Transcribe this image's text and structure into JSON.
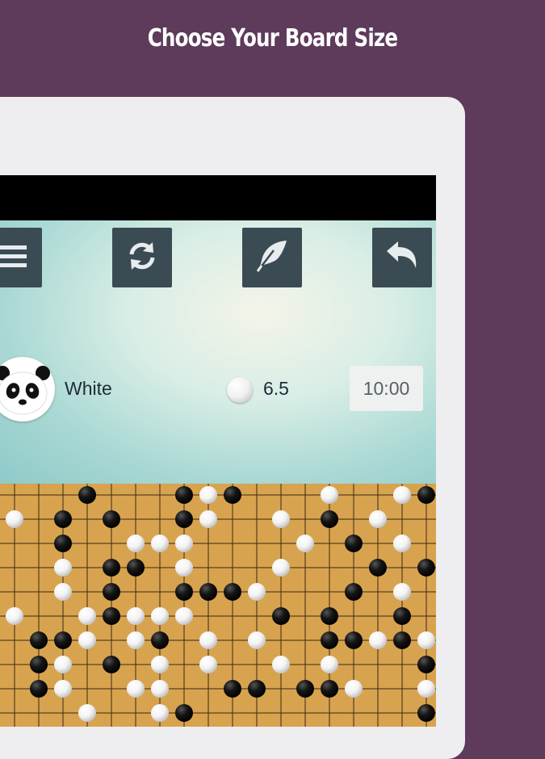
{
  "headline": "Choose Your Board Size",
  "toolbar": {
    "buttons": [
      {
        "icon": "menu-icon"
      },
      {
        "icon": "refresh-icon"
      },
      {
        "icon": "feather-icon"
      },
      {
        "icon": "undo-icon"
      }
    ]
  },
  "player": {
    "name": "White",
    "avatar": "panda-avatar",
    "komi": "6.5",
    "timer": "10:00"
  },
  "colors": {
    "background": "#5e3a5b",
    "toolbar_button": "#3b4b54",
    "board_wood": "#d8a34f"
  },
  "board": {
    "black": [
      [
        3,
        0
      ],
      [
        7,
        0
      ],
      [
        9,
        0
      ],
      [
        17,
        0
      ],
      [
        2,
        1
      ],
      [
        4,
        1
      ],
      [
        7,
        1
      ],
      [
        13,
        1
      ],
      [
        2,
        2
      ],
      [
        14,
        2
      ],
      [
        4,
        3
      ],
      [
        5,
        3
      ],
      [
        15,
        3
      ],
      [
        17,
        3
      ],
      [
        4,
        4
      ],
      [
        7,
        4
      ],
      [
        8,
        4
      ],
      [
        9,
        4
      ],
      [
        14,
        4
      ],
      [
        4,
        5
      ],
      [
        11,
        5
      ],
      [
        13,
        5
      ],
      [
        16,
        5
      ],
      [
        1,
        6
      ],
      [
        2,
        6
      ],
      [
        6,
        6
      ],
      [
        13,
        6
      ],
      [
        14,
        6
      ],
      [
        16,
        6
      ],
      [
        1,
        7
      ],
      [
        4,
        7
      ],
      [
        17,
        7
      ],
      [
        1,
        8
      ],
      [
        9,
        8
      ],
      [
        10,
        8
      ],
      [
        12,
        8
      ],
      [
        13,
        8
      ],
      [
        7,
        9
      ],
      [
        17,
        9
      ]
    ],
    "white": [
      [
        8,
        0
      ],
      [
        13,
        0
      ],
      [
        16,
        0
      ],
      [
        0,
        1
      ],
      [
        8,
        1
      ],
      [
        11,
        1
      ],
      [
        15,
        1
      ],
      [
        5,
        2
      ],
      [
        6,
        2
      ],
      [
        7,
        2
      ],
      [
        12,
        2
      ],
      [
        16,
        2
      ],
      [
        2,
        3
      ],
      [
        7,
        3
      ],
      [
        11,
        3
      ],
      [
        2,
        4
      ],
      [
        10,
        4
      ],
      [
        16,
        4
      ],
      [
        0,
        5
      ],
      [
        3,
        5
      ],
      [
        5,
        5
      ],
      [
        6,
        5
      ],
      [
        7,
        5
      ],
      [
        3,
        6
      ],
      [
        5,
        6
      ],
      [
        8,
        6
      ],
      [
        10,
        6
      ],
      [
        15,
        6
      ],
      [
        17,
        6
      ],
      [
        2,
        7
      ],
      [
        6,
        7
      ],
      [
        8,
        7
      ],
      [
        11,
        7
      ],
      [
        13,
        7
      ],
      [
        2,
        8
      ],
      [
        5,
        8
      ],
      [
        6,
        8
      ],
      [
        14,
        8
      ],
      [
        17,
        8
      ],
      [
        3,
        9
      ],
      [
        6,
        9
      ]
    ]
  }
}
